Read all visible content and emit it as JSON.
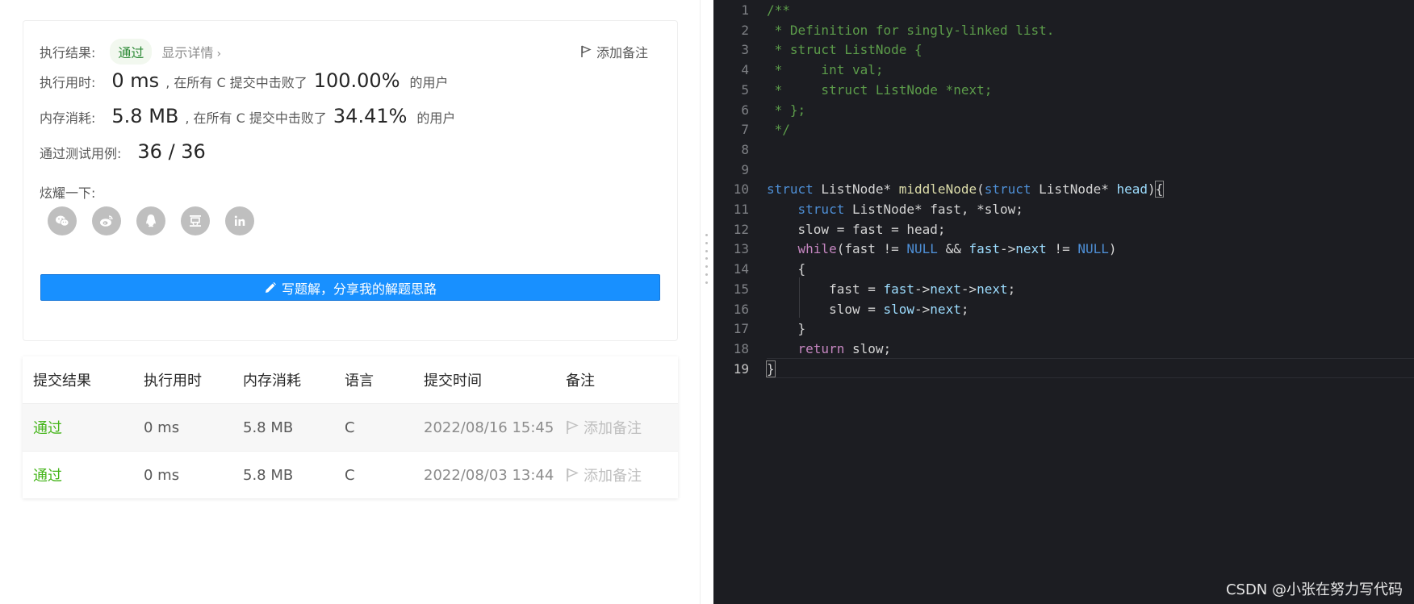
{
  "result": {
    "label": "执行结果:",
    "status": "通过",
    "detail_link": "显示详情",
    "chevron": "›",
    "add_note": "添加备注"
  },
  "runtime": {
    "label": "执行用时:",
    "value": "0 ms",
    "middle": ", 在所有 C 提交中击败了",
    "percent": "100.00%",
    "suffix": "的用户"
  },
  "memory": {
    "label": "内存消耗:",
    "value": "5.8 MB",
    "middle": ", 在所有 C 提交中击败了",
    "percent": "34.41%",
    "suffix": "的用户"
  },
  "testcases": {
    "label": "通过测试用例:",
    "value": "36 / 36"
  },
  "share": {
    "label": "炫耀一下:",
    "icons": [
      "wechat-icon",
      "weibo-icon",
      "qq-icon",
      "douban-icon",
      "linkedin-icon"
    ]
  },
  "write_button": {
    "label": "写题解，分享我的解题思路"
  },
  "submissions": {
    "headers": [
      "提交结果",
      "执行用时",
      "内存消耗",
      "语言",
      "提交时间",
      "备注"
    ],
    "rows": [
      {
        "status": "通过",
        "runtime": "0 ms",
        "memory": "5.8 MB",
        "language": "C",
        "time": "2022/08/16 15:45",
        "note": "添加备注"
      },
      {
        "status": "通过",
        "runtime": "0 ms",
        "memory": "5.8 MB",
        "language": "C",
        "time": "2022/08/03 13:44",
        "note": "添加备注"
      }
    ]
  },
  "editor": {
    "line_numbers": [
      "1",
      "2",
      "3",
      "4",
      "5",
      "6",
      "7",
      "8",
      "9",
      "10",
      "11",
      "12",
      "13",
      "14",
      "15",
      "16",
      "17",
      "18",
      "19"
    ],
    "lines": [
      [
        {
          "t": "/**",
          "c": "cmt"
        }
      ],
      [
        {
          "t": " * Definition for singly-linked list.",
          "c": "cmt"
        }
      ],
      [
        {
          "t": " * struct ListNode {",
          "c": "cmt"
        }
      ],
      [
        {
          "t": " *     int val;",
          "c": "cmt"
        }
      ],
      [
        {
          "t": " *     struct ListNode *next;",
          "c": "cmt"
        }
      ],
      [
        {
          "t": " * };",
          "c": "cmt"
        }
      ],
      [
        {
          "t": " */",
          "c": "cmt"
        }
      ],
      [],
      [],
      [
        {
          "t": "struct",
          "c": "kw"
        },
        {
          "t": " ListNode* ",
          "c": "type"
        },
        {
          "t": "middleNode",
          "c": "fn"
        },
        {
          "t": "(",
          "c": "br"
        },
        {
          "t": "struct",
          "c": "kw"
        },
        {
          "t": " ListNode* ",
          "c": "type"
        },
        {
          "t": "head",
          "c": "prm"
        },
        {
          "t": ")",
          "c": "br"
        },
        {
          "t": "{",
          "c": "br"
        }
      ],
      [
        {
          "t": "    ",
          "c": "id"
        },
        {
          "t": "struct",
          "c": "kw"
        },
        {
          "t": " ListNode* fast, *slow;",
          "c": "id"
        }
      ],
      [
        {
          "t": "    slow = fast = head;",
          "c": "id"
        }
      ],
      [
        {
          "t": "    ",
          "c": "id"
        },
        {
          "t": "while",
          "c": "ctl"
        },
        {
          "t": "(fast != ",
          "c": "id"
        },
        {
          "t": "NULL",
          "c": "null"
        },
        {
          "t": " && ",
          "c": "id"
        },
        {
          "t": "fast",
          "c": "mem"
        },
        {
          "t": "->",
          "c": "id"
        },
        {
          "t": "next",
          "c": "mem"
        },
        {
          "t": " != ",
          "c": "id"
        },
        {
          "t": "NULL",
          "c": "null"
        },
        {
          "t": ")",
          "c": "id"
        }
      ],
      [
        {
          "t": "    {",
          "c": "id"
        }
      ],
      [
        {
          "t": "        fast = ",
          "c": "id"
        },
        {
          "t": "fast",
          "c": "mem"
        },
        {
          "t": "->",
          "c": "id"
        },
        {
          "t": "next",
          "c": "mem"
        },
        {
          "t": "->",
          "c": "id"
        },
        {
          "t": "next",
          "c": "mem"
        },
        {
          "t": ";",
          "c": "id"
        }
      ],
      [
        {
          "t": "        slow = ",
          "c": "id"
        },
        {
          "t": "slow",
          "c": "mem"
        },
        {
          "t": "->",
          "c": "id"
        },
        {
          "t": "next",
          "c": "mem"
        },
        {
          "t": ";",
          "c": "id"
        }
      ],
      [
        {
          "t": "    }",
          "c": "id"
        }
      ],
      [
        {
          "t": "    ",
          "c": "id"
        },
        {
          "t": "return",
          "c": "ctl"
        },
        {
          "t": " slow;",
          "c": "id"
        }
      ],
      [
        {
          "t": "}",
          "c": "br"
        }
      ]
    ]
  },
  "watermark": "CSDN @小张在努力写代码"
}
